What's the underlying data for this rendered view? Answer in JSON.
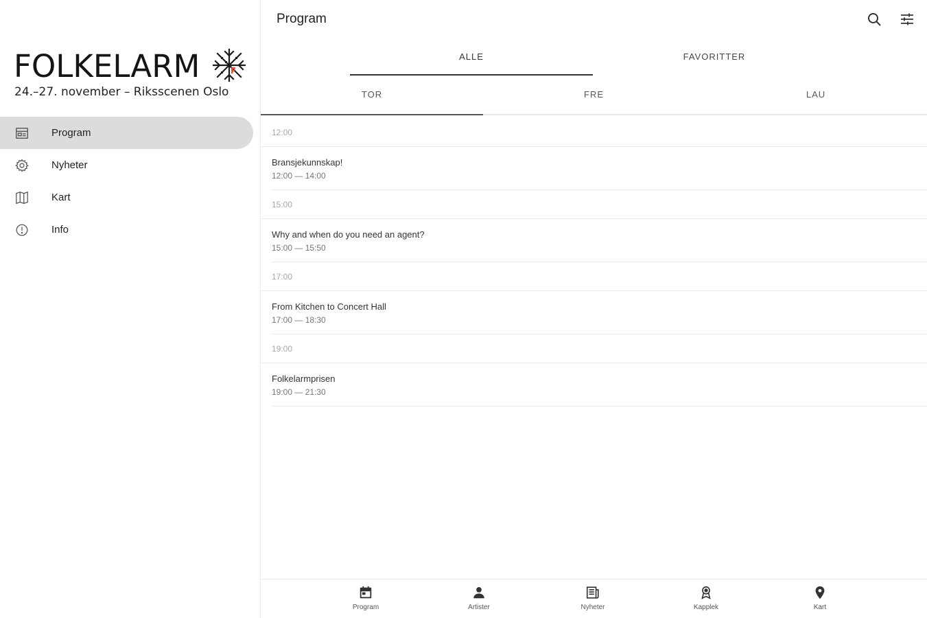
{
  "sidebar": {
    "logo_word": "FOLKELARM",
    "logo_sub": "24.–27. november – Riksscenen Oslo",
    "items": [
      {
        "label": "Program",
        "icon": "calendar-icon",
        "active": true
      },
      {
        "label": "Nyheter",
        "icon": "gear-icon",
        "active": false
      },
      {
        "label": "Kart",
        "icon": "map-icon",
        "active": false
      },
      {
        "label": "Info",
        "icon": "info-icon",
        "active": false
      }
    ]
  },
  "header": {
    "title": "Program",
    "search_icon": "search-icon",
    "filter_icon": "filter-icon"
  },
  "filter_tabs": [
    {
      "label": "ALLE",
      "active": true
    },
    {
      "label": "FAVORITTER",
      "active": false
    }
  ],
  "day_tabs": [
    {
      "label": "TOR",
      "active": true
    },
    {
      "label": "FRE",
      "active": false
    },
    {
      "label": "LAU",
      "active": false
    }
  ],
  "schedule": [
    {
      "time": "12:00",
      "title": "Bransjekunnskap!",
      "range": "12:00 — 14:00"
    },
    {
      "time": "15:00",
      "title": "Why and when do you need an agent?",
      "range": "15:00 — 15:50"
    },
    {
      "time": "17:00",
      "title": "From Kitchen to Concert Hall",
      "range": "17:00 — 18:30"
    },
    {
      "time": "19:00",
      "title": "Folkelarmprisen",
      "range": "19:00 — 21:30"
    }
  ],
  "bottom_nav": [
    {
      "label": "Program",
      "icon": "calendar-icon"
    },
    {
      "label": "Artister",
      "icon": "person-icon"
    },
    {
      "label": "Nyheter",
      "icon": "newspaper-icon"
    },
    {
      "label": "Kapplek",
      "icon": "award-icon"
    },
    {
      "label": "Kart",
      "icon": "pin-icon"
    }
  ],
  "colors": {
    "active_nav_bg": "#dcdcdc",
    "logo_accent": "#e0533a",
    "divider": "#ececec"
  }
}
